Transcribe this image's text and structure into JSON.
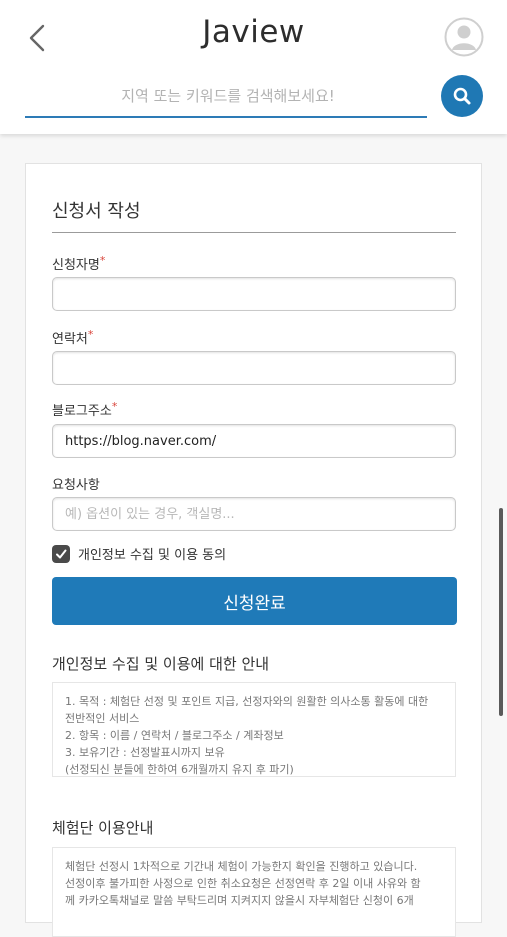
{
  "header": {
    "app_title": "Jaview",
    "search_placeholder": "지역 또는 키워드를 검색해보세요!"
  },
  "form": {
    "title": "신청서 작성",
    "fields": [
      {
        "label": "신청자명",
        "required": true,
        "value": "",
        "placeholder": ""
      },
      {
        "label": "연락처",
        "required": true,
        "value": "",
        "placeholder": ""
      },
      {
        "label": "블로그주소",
        "required": true,
        "value": "https://blog.naver.com/",
        "placeholder": ""
      },
      {
        "label": "요청사항",
        "required": false,
        "value": "",
        "placeholder": "예) 옵션이 있는 경우, 객실명..."
      }
    ],
    "required_mark": "*",
    "consent_label": "개인정보 수집 및 이용 동의",
    "consent_checked": true,
    "submit_label": "신청완료"
  },
  "privacy": {
    "title": "개인정보 수집 및 이용에 대한 안내",
    "lines": [
      "1. 목적 : 체험단 선정 및 포인트 지급, 선정자와의 원활한 의사소통 활동에 대한",
      "전반적인 서비스",
      "2. 항목 : 이름 / 연락처 / 블로그주소 / 계좌정보",
      "3. 보유기간 : 선정발표시까지 보유",
      "(선정되신 분들에 한하여 6개월까지 유지 후 파기)"
    ]
  },
  "guide": {
    "title": "체험단 이용안내",
    "lines": [
      "체험단 선정시 1차적으로 기간내 체험이 가능한지 확인을 진행하고 있습니다.",
      "선정이후 불가피한 사정으로 인한 취소요청은 선정연락 후 2일 이내 사유와 함",
      "께 카카오톡채널로 말씀 부탁드리며 지켜지지 않을시 자부체험단 신청이 6개"
    ]
  },
  "colors": {
    "accent": "#1f7ab8",
    "required": "#d9453b"
  }
}
